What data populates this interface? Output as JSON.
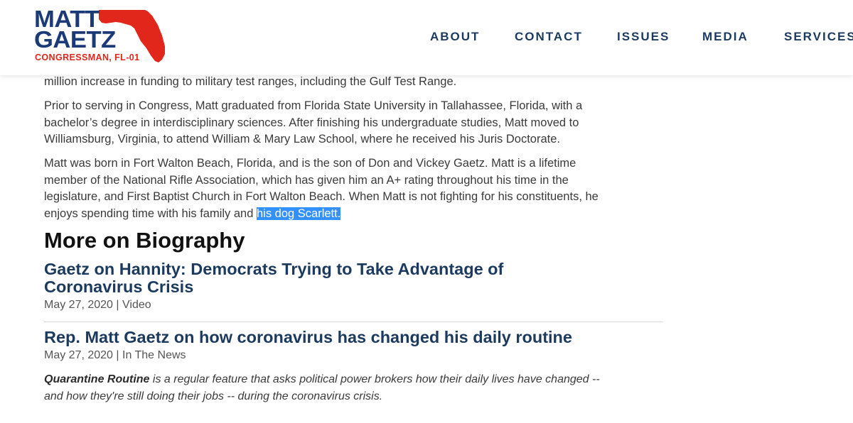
{
  "brand": {
    "first_name": "MATT",
    "last_name": "GAETZ",
    "subtitle": "CONGRESSMAN, FL-01",
    "navy": "#1c3a77",
    "red": "#e1261c"
  },
  "nav": {
    "about": "ABOUT",
    "contact": "CONTACT",
    "issues": "ISSUES",
    "media": "MEDIA",
    "services": "SERVICES"
  },
  "bio": {
    "p0_line1": "million increase in funding to military test ranges, including the Gulf Test Range.",
    "p1_line1": "Prior to serving in Congress, Matt graduated from Florida State University in Tallahassee, Florida, with a",
    "p1_line2": "bachelor’s degree in interdisciplinary sciences. After finishing his undergraduate studies, Matt moved to",
    "p1_line3": "Williamsburg, Virginia, to attend William & Mary Law School, where he received his Juris Doctorate.",
    "p2_line1": "Matt was born in Fort Walton Beach, Florida, and is the son of Don and Vickey Gaetz. Matt is a lifetime",
    "p2_line2": "member of the National Rifle Association, which has given him an A+ rating throughout his time in the",
    "p2_line3": "legislature, and First Baptist Church in Fort Walton Beach. When Matt is not fighting for his constituents, he",
    "p2_line4_pre": "enjoys spending time with his family and ",
    "p2_line4_selected": "his dog Scarlett."
  },
  "more": {
    "heading": "More on Biography",
    "articles": [
      {
        "title_line1": "Gaetz on Hannity: Democrats Trying to Take Advantage of",
        "title_line2": "Coronavirus Crisis",
        "meta": "May 27, 2020 | Video"
      },
      {
        "title_line1": "Rep. Matt Gaetz on how coronavirus has changed his daily routine",
        "meta": "May 27, 2020 | In The News",
        "excerpt_bold": "Quarantine Routine",
        "excerpt_line1_rest": " is a regular feature that asks political power brokers how their daily lives have changed --",
        "excerpt_line2": "and how they're still doing their jobs -- during the coronavirus crisis."
      }
    ]
  }
}
